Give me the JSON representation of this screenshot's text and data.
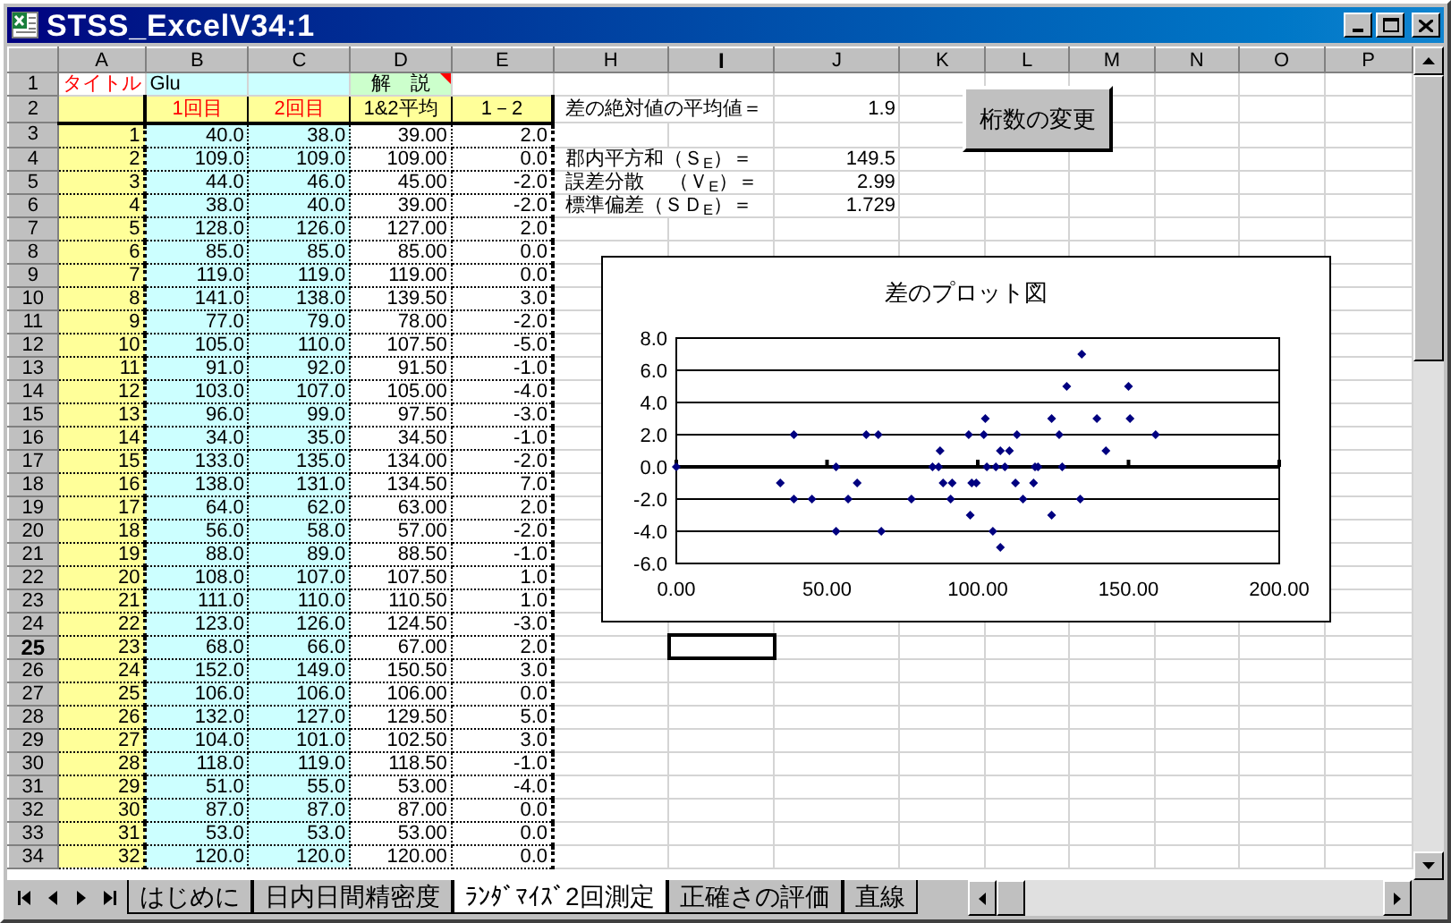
{
  "window": {
    "title": "STSS_ExcelV34:1"
  },
  "columns": [
    {
      "label": "A",
      "selected": false
    },
    {
      "label": "B",
      "selected": false
    },
    {
      "label": "C",
      "selected": false
    },
    {
      "label": "D",
      "selected": false
    },
    {
      "label": "E",
      "selected": false
    },
    {
      "label": "H",
      "selected": false
    },
    {
      "label": "I",
      "selected": true
    },
    {
      "label": "J",
      "selected": false
    },
    {
      "label": "K",
      "selected": false
    },
    {
      "label": "L",
      "selected": false
    },
    {
      "label": "M",
      "selected": false
    },
    {
      "label": "N",
      "selected": false
    },
    {
      "label": "O",
      "selected": false
    },
    {
      "label": "P",
      "selected": false
    }
  ],
  "rows": [
    {
      "number": "1",
      "kind": "title",
      "selected": false,
      "cells": [
        "タイトル",
        "Glu",
        null,
        "解　説",
        null
      ]
    },
    {
      "number": "2",
      "kind": "header",
      "selected": false,
      "cells": [
        null,
        "1回目",
        "2回目",
        "1&2平均",
        "1－2"
      ],
      "stat": {
        "label": "差の絶対値の平均値＝",
        "value": "1.9"
      }
    },
    {
      "number": "3",
      "kind": "data",
      "selected": false,
      "cells": [
        "1",
        "40.0",
        "38.0",
        "39.00",
        "2.0"
      ]
    },
    {
      "number": "4",
      "kind": "data",
      "selected": false,
      "cells": [
        "2",
        "109.0",
        "109.0",
        "109.00",
        "0.0"
      ],
      "stat": {
        "label": "郡内平方和（Ｓ$_{E}$）＝",
        "value": "149.5"
      }
    },
    {
      "number": "5",
      "kind": "data",
      "selected": false,
      "cells": [
        "3",
        "44.0",
        "46.0",
        "45.00",
        "-2.0"
      ],
      "stat": {
        "label": "誤差分散　 （Ｖ$_{E}$）＝",
        "value": "2.99"
      }
    },
    {
      "number": "6",
      "kind": "data",
      "selected": false,
      "cells": [
        "4",
        "38.0",
        "40.0",
        "39.00",
        "-2.0"
      ],
      "stat": {
        "label": "標準偏差（ＳＤ$_{E}$）＝",
        "value": "1.729"
      }
    },
    {
      "number": "7",
      "kind": "data",
      "selected": false,
      "cells": [
        "5",
        "128.0",
        "126.0",
        "127.00",
        "2.0"
      ]
    },
    {
      "number": "8",
      "kind": "data",
      "selected": false,
      "cells": [
        "6",
        "85.0",
        "85.0",
        "85.00",
        "0.0"
      ]
    },
    {
      "number": "9",
      "kind": "data",
      "selected": false,
      "cells": [
        "7",
        "119.0",
        "119.0",
        "119.00",
        "0.0"
      ]
    },
    {
      "number": "10",
      "kind": "data",
      "selected": false,
      "cells": [
        "8",
        "141.0",
        "138.0",
        "139.50",
        "3.0"
      ]
    },
    {
      "number": "11",
      "kind": "data",
      "selected": false,
      "cells": [
        "9",
        "77.0",
        "79.0",
        "78.00",
        "-2.0"
      ]
    },
    {
      "number": "12",
      "kind": "data",
      "selected": false,
      "cells": [
        "10",
        "105.0",
        "110.0",
        "107.50",
        "-5.0"
      ]
    },
    {
      "number": "13",
      "kind": "data",
      "selected": false,
      "cells": [
        "11",
        "91.0",
        "92.0",
        "91.50",
        "-1.0"
      ]
    },
    {
      "number": "14",
      "kind": "data",
      "selected": false,
      "cells": [
        "12",
        "103.0",
        "107.0",
        "105.00",
        "-4.0"
      ]
    },
    {
      "number": "15",
      "kind": "data",
      "selected": false,
      "cells": [
        "13",
        "96.0",
        "99.0",
        "97.50",
        "-3.0"
      ]
    },
    {
      "number": "16",
      "kind": "data",
      "selected": false,
      "cells": [
        "14",
        "34.0",
        "35.0",
        "34.50",
        "-1.0"
      ]
    },
    {
      "number": "17",
      "kind": "data",
      "selected": false,
      "cells": [
        "15",
        "133.0",
        "135.0",
        "134.00",
        "-2.0"
      ]
    },
    {
      "number": "18",
      "kind": "data",
      "selected": false,
      "cells": [
        "16",
        "138.0",
        "131.0",
        "134.50",
        "7.0"
      ]
    },
    {
      "number": "19",
      "kind": "data",
      "selected": false,
      "cells": [
        "17",
        "64.0",
        "62.0",
        "63.00",
        "2.0"
      ]
    },
    {
      "number": "20",
      "kind": "data",
      "selected": false,
      "cells": [
        "18",
        "56.0",
        "58.0",
        "57.00",
        "-2.0"
      ]
    },
    {
      "number": "21",
      "kind": "data",
      "selected": false,
      "cells": [
        "19",
        "88.0",
        "89.0",
        "88.50",
        "-1.0"
      ]
    },
    {
      "number": "22",
      "kind": "data",
      "selected": false,
      "cells": [
        "20",
        "108.0",
        "107.0",
        "107.50",
        "1.0"
      ]
    },
    {
      "number": "23",
      "kind": "data",
      "selected": false,
      "cells": [
        "21",
        "111.0",
        "110.0",
        "110.50",
        "1.0"
      ]
    },
    {
      "number": "24",
      "kind": "data",
      "selected": false,
      "cells": [
        "22",
        "123.0",
        "126.0",
        "124.50",
        "-3.0"
      ]
    },
    {
      "number": "25",
      "kind": "data",
      "selected": true,
      "cells": [
        "23",
        "68.0",
        "66.0",
        "67.00",
        "2.0"
      ]
    },
    {
      "number": "26",
      "kind": "data",
      "selected": false,
      "cells": [
        "24",
        "152.0",
        "149.0",
        "150.50",
        "3.0"
      ]
    },
    {
      "number": "27",
      "kind": "data",
      "selected": false,
      "cells": [
        "25",
        "106.0",
        "106.0",
        "106.00",
        "0.0"
      ]
    },
    {
      "number": "28",
      "kind": "data",
      "selected": false,
      "cells": [
        "26",
        "132.0",
        "127.0",
        "129.50",
        "5.0"
      ]
    },
    {
      "number": "29",
      "kind": "data",
      "selected": false,
      "cells": [
        "27",
        "104.0",
        "101.0",
        "102.50",
        "3.0"
      ]
    },
    {
      "number": "30",
      "kind": "data",
      "selected": false,
      "cells": [
        "28",
        "118.0",
        "119.0",
        "118.50",
        "-1.0"
      ]
    },
    {
      "number": "31",
      "kind": "data",
      "selected": false,
      "cells": [
        "29",
        "51.0",
        "55.0",
        "53.00",
        "-4.0"
      ]
    },
    {
      "number": "32",
      "kind": "data",
      "selected": false,
      "cells": [
        "30",
        "87.0",
        "87.0",
        "87.00",
        "0.0"
      ]
    },
    {
      "number": "33",
      "kind": "data",
      "selected": false,
      "cells": [
        "31",
        "53.0",
        "53.0",
        "53.00",
        "0.0"
      ]
    },
    {
      "number": "34",
      "kind": "data",
      "selected": false,
      "cells": [
        "32",
        "120.0",
        "120.0",
        "120.00",
        "0.0"
      ]
    }
  ],
  "button": {
    "label": "桁数の変更"
  },
  "chart": {
    "chart_data": {
      "type": "scatter",
      "title": "差のプロット図",
      "grid": true,
      "x": [
        0,
        34.5,
        39,
        39,
        45,
        53,
        53,
        57,
        60,
        63,
        67,
        68,
        78,
        85,
        87,
        87.5,
        88.5,
        91.5,
        91,
        97,
        97.5,
        98,
        99.5,
        102,
        102.5,
        103,
        105,
        106,
        107.5,
        107.5,
        109,
        110.5,
        112.5,
        113,
        115,
        118.5,
        119,
        120,
        124.5,
        124.5,
        127,
        128,
        129.5,
        134,
        134.5,
        139.5,
        142.5,
        150,
        150.5,
        159
      ],
      "series": [
        {
          "color": "#000080",
          "values": [
            0,
            -1,
            2,
            -2,
            -2,
            0,
            -4,
            -2,
            -1,
            2,
            2,
            -4,
            -2,
            0,
            0,
            1,
            -1,
            -1,
            -2,
            2,
            -3,
            -1,
            -1,
            2,
            3,
            0,
            -4,
            0,
            1,
            -5,
            0,
            1,
            -1,
            2,
            -2,
            -1,
            0,
            0,
            3,
            -3,
            2,
            0,
            5,
            -2,
            7,
            3,
            1,
            5,
            3,
            2
          ]
        }
      ],
      "xlim": [
        0,
        200
      ],
      "ylim": [
        -6,
        8
      ],
      "xticks": [
        {
          "value": 0,
          "label": "0.00"
        },
        {
          "value": 50,
          "label": "50.00"
        },
        {
          "value": 100,
          "label": "100.00"
        },
        {
          "value": 150,
          "label": "150.00"
        },
        {
          "value": 200,
          "label": "200.00"
        }
      ],
      "yticks": [
        {
          "value": -6,
          "label": "-6.0"
        },
        {
          "value": -4,
          "label": "-4.0"
        },
        {
          "value": -2,
          "label": "-2.0"
        },
        {
          "value": 0,
          "label": "0.0"
        },
        {
          "value": 2,
          "label": "2.0"
        },
        {
          "value": 4,
          "label": "4.0"
        },
        {
          "value": 6,
          "label": "6.0"
        },
        {
          "value": 8,
          "label": "8.0"
        }
      ]
    }
  },
  "sheet_tabs": [
    {
      "label": "はじめに",
      "selected": false
    },
    {
      "label": "日内日間精密度",
      "selected": false
    },
    {
      "label": "ﾗﾝﾀﾞﾏｲｽﾞ2回測定",
      "selected": true
    },
    {
      "label": "正確さの評価",
      "selected": false
    },
    {
      "label": "直線",
      "selected": false
    }
  ]
}
